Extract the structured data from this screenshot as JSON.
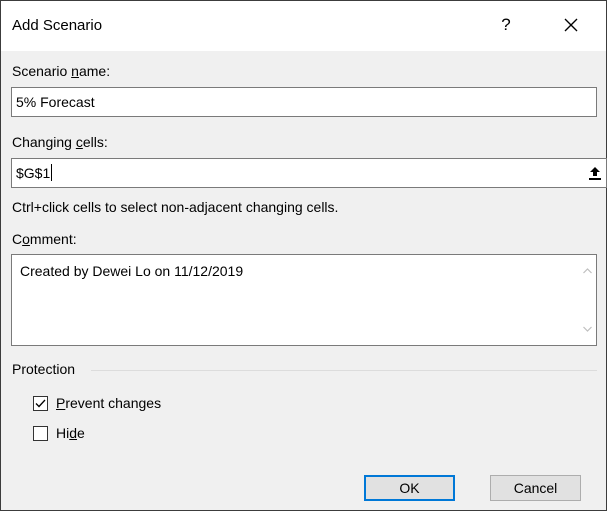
{
  "window": {
    "title": "Add Scenario",
    "help_glyph": "?",
    "close_icon": "close-icon"
  },
  "scenario_name": {
    "label_pre": "Scenario ",
    "label_access": "n",
    "label_post": "ame:",
    "value": "5% Forecast"
  },
  "changing_cells": {
    "label_pre": "Changing ",
    "label_access": "c",
    "label_post": "ells:",
    "value": "$G$1",
    "collapse_icon": "collapse-dialog-icon",
    "hint": "Ctrl+click cells to select non-adjacent changing cells."
  },
  "comment": {
    "label_pre": "C",
    "label_access": "o",
    "label_post": "mment:",
    "value": "Created by Dewei Lo on 11/12/2019"
  },
  "protection": {
    "heading": "Protection",
    "prevent_changes": {
      "label_access": "P",
      "label_post": "revent changes",
      "checked": true
    },
    "hide": {
      "label_pre": "Hi",
      "label_access": "d",
      "label_post": "e",
      "checked": false
    }
  },
  "buttons": {
    "ok": "OK",
    "cancel": "Cancel"
  },
  "colors": {
    "dialog_bg": "#f0f0f0",
    "default_button_border": "#0078d7"
  }
}
